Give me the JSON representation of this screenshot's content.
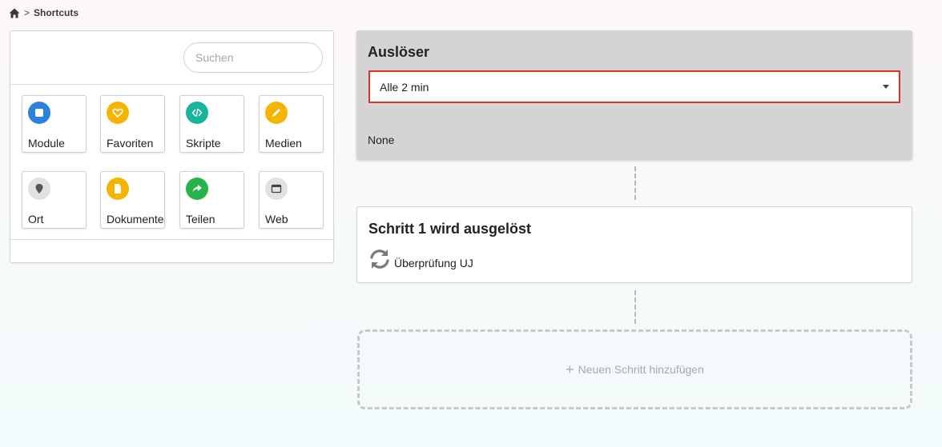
{
  "breadcrumb": {
    "home_icon": "home-icon",
    "separator": ">",
    "current": "Shortcuts"
  },
  "search": {
    "placeholder": "Suchen",
    "value": ""
  },
  "tiles": [
    {
      "label": "Module",
      "icon": "square-icon",
      "color": "#2a82da"
    },
    {
      "label": "Favoriten",
      "icon": "heart-icon",
      "color": "#f5b400"
    },
    {
      "label": "Skripte",
      "icon": "code-icon",
      "color": "#1ab39b"
    },
    {
      "label": "Medien",
      "icon": "pencil-icon",
      "color": "#f5b400"
    },
    {
      "label": "Ort",
      "icon": "location-pin-icon",
      "color": "#e2e2e2"
    },
    {
      "label": "Dokumente",
      "icon": "document-icon",
      "color": "#f5b400"
    },
    {
      "label": "Teilen",
      "icon": "share-icon",
      "color": "#27b34a"
    },
    {
      "label": "Web",
      "icon": "browser-window-icon",
      "color": "#e2e2e2"
    }
  ],
  "trigger": {
    "title": "Auslöser",
    "select_value": "Alle 2 min",
    "value_text": "None"
  },
  "step": {
    "title": "Schritt 1 wird ausgelöst",
    "icon": "sync-icon",
    "label": "Überprüfung UJ"
  },
  "add_step": {
    "icon": "plus-icon",
    "label": "Neuen Schritt hinzufügen"
  },
  "colors": {
    "select_border": "#e0321c",
    "trigger_bg": "#d4d4d4"
  }
}
